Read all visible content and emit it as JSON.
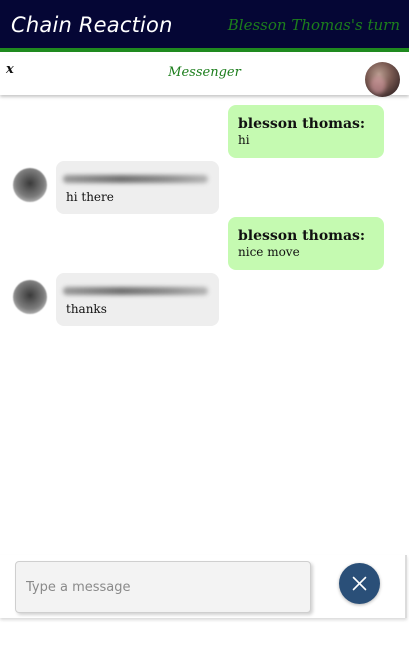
{
  "app": {
    "title": "Chain Reaction",
    "turn_text": "Blesson Thomas's turn"
  },
  "messenger": {
    "close_label": "x",
    "title": "Messenger"
  },
  "messages": [
    {
      "direction": "outgoing",
      "sender": "blesson thomas:",
      "text": "hi"
    },
    {
      "direction": "incoming",
      "sender_blurred": true,
      "text": "hi there"
    },
    {
      "direction": "outgoing",
      "sender": "blesson thomas:",
      "text": "nice move"
    },
    {
      "direction": "incoming",
      "sender_blurred": true,
      "text": "thanks"
    }
  ],
  "composer": {
    "placeholder": "Type a message",
    "value": "",
    "send_icon": "close-icon"
  },
  "colors": {
    "topbar_bg": "#050635",
    "accent_green": "#1c7e1c",
    "outgoing_bubble": "#c5fab1",
    "incoming_bubble": "#eeeeee",
    "send_button": "#2a4f78"
  }
}
